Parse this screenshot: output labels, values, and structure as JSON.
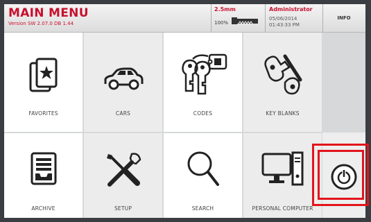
{
  "header": {
    "title": "MAIN MENU",
    "version": "Version SW 2.07.0 DB 1.44",
    "blade_size": "2.5mm",
    "percent": "100%",
    "user": "Administrator",
    "date": "05/06/2014",
    "time": "01:43:33 PM",
    "info_label": "INFO"
  },
  "menu": {
    "favorites": "FAVORITES",
    "cars": "CARS",
    "codes": "CODES",
    "key_blanks": "KEY BLANKS",
    "archive": "ARCHIVE",
    "setup": "SETUP",
    "search": "SEARCH",
    "personal_computer": "PERSONAL COMPUTER"
  },
  "colors": {
    "accent": "#c8102e",
    "highlight": "#e3141b"
  }
}
